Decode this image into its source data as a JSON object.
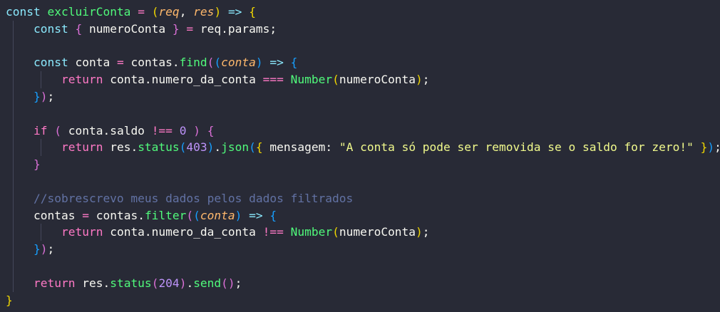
{
  "editor": {
    "background": "#282a36",
    "lines": [
      {
        "indent": 0,
        "tokens": [
          {
            "t": "const ",
            "c": "dc"
          },
          {
            "t": "excluirConta",
            "c": "fn"
          },
          {
            "t": " ",
            "c": "pl"
          },
          {
            "t": "=",
            "c": "kw"
          },
          {
            "t": " ",
            "c": "pl"
          },
          {
            "t": "(",
            "c": "b1"
          },
          {
            "t": "req",
            "c": "pa"
          },
          {
            "t": ", ",
            "c": "pl"
          },
          {
            "t": "res",
            "c": "pa"
          },
          {
            "t": ")",
            "c": "b1"
          },
          {
            "t": " ",
            "c": "pl"
          },
          {
            "t": "=>",
            "c": "dc"
          },
          {
            "t": " ",
            "c": "pl"
          },
          {
            "t": "{",
            "c": "b1"
          }
        ]
      },
      {
        "indent": 1,
        "tokens": [
          {
            "t": "const ",
            "c": "dc"
          },
          {
            "t": "{",
            "c": "b2"
          },
          {
            "t": " numeroConta ",
            "c": "pl"
          },
          {
            "t": "}",
            "c": "b2"
          },
          {
            "t": " ",
            "c": "pl"
          },
          {
            "t": "=",
            "c": "kw"
          },
          {
            "t": " req.params;",
            "c": "pl"
          }
        ]
      },
      {
        "indent": 1,
        "tokens": []
      },
      {
        "indent": 1,
        "tokens": [
          {
            "t": "const ",
            "c": "dc"
          },
          {
            "t": "conta ",
            "c": "pl"
          },
          {
            "t": "=",
            "c": "kw"
          },
          {
            "t": " contas.",
            "c": "pl"
          },
          {
            "t": "find",
            "c": "fn"
          },
          {
            "t": "(",
            "c": "b2"
          },
          {
            "t": "(",
            "c": "b3"
          },
          {
            "t": "conta",
            "c": "pa"
          },
          {
            "t": ")",
            "c": "b3"
          },
          {
            "t": " ",
            "c": "pl"
          },
          {
            "t": "=>",
            "c": "dc"
          },
          {
            "t": " ",
            "c": "pl"
          },
          {
            "t": "{",
            "c": "b3"
          }
        ]
      },
      {
        "indent": 2,
        "tokens": [
          {
            "t": "return ",
            "c": "kw"
          },
          {
            "t": "conta.numero_da_conta ",
            "c": "pl"
          },
          {
            "t": "===",
            "c": "kw"
          },
          {
            "t": " ",
            "c": "pl"
          },
          {
            "t": "Number",
            "c": "fn"
          },
          {
            "t": "(",
            "c": "b1"
          },
          {
            "t": "numeroConta",
            "c": "pl"
          },
          {
            "t": ")",
            "c": "b1"
          },
          {
            "t": ";",
            "c": "pl"
          }
        ]
      },
      {
        "indent": 1,
        "tokens": [
          {
            "t": "}",
            "c": "b3"
          },
          {
            "t": ")",
            "c": "b2"
          },
          {
            "t": ";",
            "c": "pl"
          }
        ]
      },
      {
        "indent": 1,
        "tokens": []
      },
      {
        "indent": 1,
        "tokens": [
          {
            "t": "if",
            "c": "kw"
          },
          {
            "t": " ",
            "c": "pl"
          },
          {
            "t": "(",
            "c": "b2"
          },
          {
            "t": " conta.saldo ",
            "c": "pl"
          },
          {
            "t": "!==",
            "c": "kw"
          },
          {
            "t": " ",
            "c": "pl"
          },
          {
            "t": "0",
            "c": "nu"
          },
          {
            "t": " ",
            "c": "pl"
          },
          {
            "t": ")",
            "c": "b2"
          },
          {
            "t": " ",
            "c": "pl"
          },
          {
            "t": "{",
            "c": "b2"
          }
        ]
      },
      {
        "indent": 2,
        "tokens": [
          {
            "t": "return ",
            "c": "kw"
          },
          {
            "t": "res.",
            "c": "pl"
          },
          {
            "t": "status",
            "c": "fn"
          },
          {
            "t": "(",
            "c": "b3"
          },
          {
            "t": "403",
            "c": "nu"
          },
          {
            "t": ")",
            "c": "b3"
          },
          {
            "t": ".",
            "c": "pl"
          },
          {
            "t": "json",
            "c": "fn"
          },
          {
            "t": "(",
            "c": "b3"
          },
          {
            "t": "{",
            "c": "b1"
          },
          {
            "t": " mensagem: ",
            "c": "pl"
          },
          {
            "t": "\"A conta só pode ser removida se o saldo for zero!\"",
            "c": "st"
          },
          {
            "t": " ",
            "c": "pl"
          },
          {
            "t": "}",
            "c": "b1"
          },
          {
            "t": ")",
            "c": "b3"
          },
          {
            "t": ";",
            "c": "pl"
          }
        ]
      },
      {
        "indent": 1,
        "tokens": [
          {
            "t": "}",
            "c": "b2"
          }
        ]
      },
      {
        "indent": 1,
        "tokens": []
      },
      {
        "indent": 1,
        "tokens": [
          {
            "t": "//sobrescrevo meus dados pelos dados filtrados",
            "c": "cm"
          }
        ]
      },
      {
        "indent": 1,
        "tokens": [
          {
            "t": "contas ",
            "c": "pl"
          },
          {
            "t": "=",
            "c": "kw"
          },
          {
            "t": " contas.",
            "c": "pl"
          },
          {
            "t": "filter",
            "c": "fn"
          },
          {
            "t": "(",
            "c": "b2"
          },
          {
            "t": "(",
            "c": "b3"
          },
          {
            "t": "conta",
            "c": "pa"
          },
          {
            "t": ")",
            "c": "b3"
          },
          {
            "t": " ",
            "c": "pl"
          },
          {
            "t": "=>",
            "c": "dc"
          },
          {
            "t": " ",
            "c": "pl"
          },
          {
            "t": "{",
            "c": "b3"
          }
        ]
      },
      {
        "indent": 2,
        "tokens": [
          {
            "t": "return ",
            "c": "kw"
          },
          {
            "t": "conta.numero_da_conta ",
            "c": "pl"
          },
          {
            "t": "!==",
            "c": "kw"
          },
          {
            "t": " ",
            "c": "pl"
          },
          {
            "t": "Number",
            "c": "fn"
          },
          {
            "t": "(",
            "c": "b1"
          },
          {
            "t": "numeroConta",
            "c": "pl"
          },
          {
            "t": ")",
            "c": "b1"
          },
          {
            "t": ";",
            "c": "pl"
          }
        ]
      },
      {
        "indent": 1,
        "tokens": [
          {
            "t": "}",
            "c": "b3"
          },
          {
            "t": ")",
            "c": "b2"
          },
          {
            "t": ";",
            "c": "pl"
          }
        ]
      },
      {
        "indent": 1,
        "tokens": []
      },
      {
        "indent": 1,
        "tokens": [
          {
            "t": "return ",
            "c": "kw"
          },
          {
            "t": "res.",
            "c": "pl"
          },
          {
            "t": "status",
            "c": "fn"
          },
          {
            "t": "(",
            "c": "b2"
          },
          {
            "t": "204",
            "c": "nu"
          },
          {
            "t": ")",
            "c": "b2"
          },
          {
            "t": ".",
            "c": "pl"
          },
          {
            "t": "send",
            "c": "fn"
          },
          {
            "t": "(",
            "c": "b2"
          },
          {
            "t": ")",
            "c": "b2"
          },
          {
            "t": ";",
            "c": "pl"
          }
        ]
      },
      {
        "indent": 0,
        "tokens": [
          {
            "t": "}",
            "c": "b1"
          }
        ]
      }
    ]
  }
}
